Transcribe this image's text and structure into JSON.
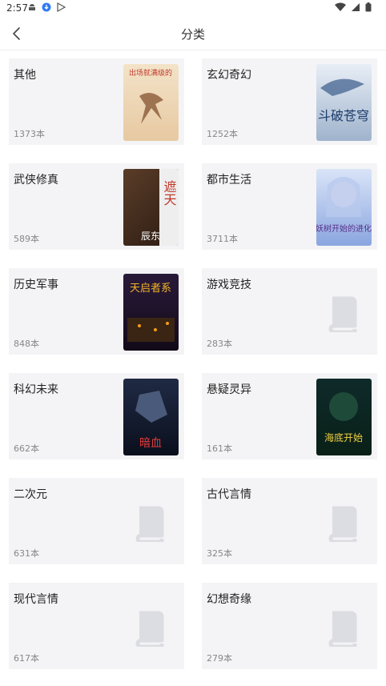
{
  "status": {
    "time": "2:57"
  },
  "header": {
    "title": "分类"
  },
  "categories": [
    {
      "name": "其他",
      "count": "1373本",
      "cover": "crane"
    },
    {
      "name": "玄幻奇幻",
      "count": "1252本",
      "cover": "dragon"
    },
    {
      "name": "武侠修真",
      "count": "589本",
      "cover": "warrior"
    },
    {
      "name": "都市生活",
      "count": "3711本",
      "cover": "anime-girl"
    },
    {
      "name": "历史军事",
      "count": "848本",
      "cover": "night-city"
    },
    {
      "name": "游戏竞技",
      "count": "283本",
      "cover": "placeholder"
    },
    {
      "name": "科幻未来",
      "count": "662本",
      "cover": "dark-mech"
    },
    {
      "name": "悬疑灵异",
      "count": "161本",
      "cover": "green-sea"
    },
    {
      "name": "二次元",
      "count": "631本",
      "cover": "placeholder"
    },
    {
      "name": "古代言情",
      "count": "325本",
      "cover": "placeholder"
    },
    {
      "name": "现代言情",
      "count": "617本",
      "cover": "placeholder"
    },
    {
      "name": "幻想奇缘",
      "count": "279本",
      "cover": "placeholder"
    }
  ],
  "cover_texts": {
    "crane": "出场就满级的",
    "dragon": "斗破苍穹",
    "warrior_a": "遮天",
    "warrior_b": "辰东",
    "anime": "妖树开始的进化",
    "night": "天启者系",
    "dark": "暗血",
    "sea": "海底开始"
  }
}
